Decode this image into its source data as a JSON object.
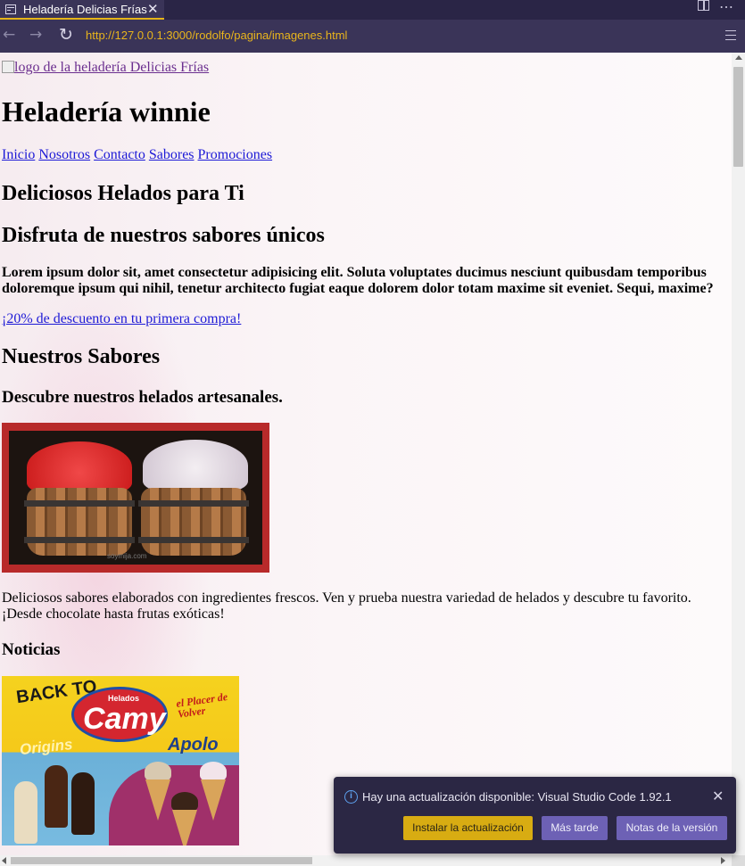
{
  "tab": {
    "title": "Heladería Delicias Frías",
    "close": "✕"
  },
  "nav": {
    "back": "←",
    "forward": "→",
    "reload": "↻",
    "url": "http://127.0.0.1:3000/rodolfo/pagina/imagenes.html"
  },
  "page": {
    "logo_alt": "logo de la heladería Delicias Frías",
    "title": "Heladería winnie",
    "menu": [
      "Inicio",
      "Nosotros",
      "Contacto",
      "Sabores",
      "Promociones"
    ],
    "hero_heading": "Deliciosos Helados para Ti",
    "hero_subheading": "Disfruta de nuestros sabores únicos",
    "lorem": "Lorem ipsum dolor sit, amet consectetur adipisicing elit. Soluta voluptates ducimus nesciunt quibusdam temporibus doloremque ipsum qui nihil, tenetur architecto fugiat eaque dolorem dolor totam maxime sit eveniet. Sequi, maxime?",
    "promo_link": "¡20% de descuento en tu primera compra!",
    "flavors_heading": "Nuestros Sabores",
    "flavors_subheading": "Descubre nuestros helados artesanales.",
    "image1_watermark": "soymija.com",
    "flavors_text": "Deliciosos sabores elaborados con ingredientes frescos. Ven y prueba nuestra variedad de helados y descubre tu favorito. ¡Desde chocolate hasta frutas exóticas!",
    "news_heading": "Noticias",
    "ad": {
      "back_to": "BACK TO",
      "brand_top": "Helados",
      "brand": "Camy",
      "slogan": "el Placer de Volver",
      "line1": "Origins",
      "line2": "Apolo"
    }
  },
  "toast": {
    "message": "Hay una actualización disponible: Visual Studio Code 1.92.1",
    "install": "Instalar la actualización",
    "later": "Más tarde",
    "notes": "Notas de la versión",
    "close": "✕",
    "info": "i"
  },
  "colors": {
    "accent": "#e5b417",
    "chrome": "#3a3458",
    "link": "#1d1ad6",
    "visited": "#6b2f8f",
    "button_primary": "#d8ac12",
    "button_secondary": "#6d61b5"
  }
}
